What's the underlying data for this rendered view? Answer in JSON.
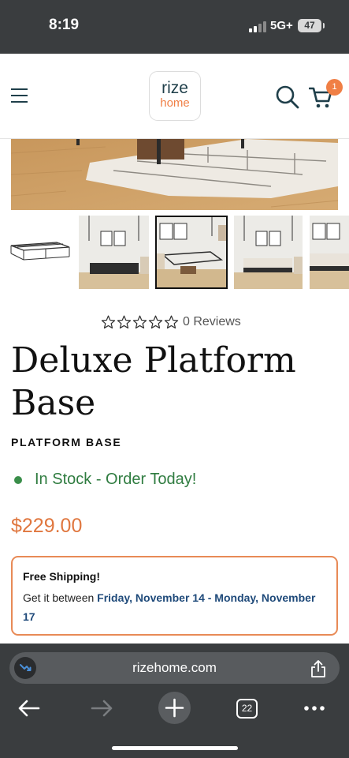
{
  "status_bar": {
    "time": "8:19",
    "network": "5G+",
    "battery": "47"
  },
  "header": {
    "logo_line1": "rize",
    "logo_line2": "home",
    "cart_count": "1",
    "icons": [
      "hamburger-menu-icon",
      "search-icon",
      "cart-icon"
    ]
  },
  "gallery": {
    "hero": "bedroom-floor-rug-image",
    "thumbnails": [
      "bed-frame-product",
      "room-scene-1",
      "room-scene-2",
      "room-scene-3",
      "room-scene-4"
    ],
    "selected_index": 2
  },
  "product": {
    "reviews_text": "0 Reviews",
    "rating": 0,
    "max_rating": 5,
    "title": "Deluxe Platform Base",
    "subtitle": "PLATFORM BASE",
    "stock_text": "In Stock - Order Today!",
    "price": "$229.00"
  },
  "shipping": {
    "title": "Free Shipping!",
    "prefix": "Get it between ",
    "dates": "Friday, November 14 - Monday, November 17"
  },
  "browser": {
    "url": "rizehome.com",
    "tab_count": "22",
    "icons": [
      "back-arrow-icon",
      "forward-arrow-icon",
      "new-tab-plus-icon",
      "tabs-icon",
      "more-icon",
      "share-icon"
    ]
  },
  "colors": {
    "accent": "#f07f45",
    "brand_dark": "#1f3f4a",
    "stock_green": "#2f7c40",
    "date_blue": "#1f4a7a"
  }
}
